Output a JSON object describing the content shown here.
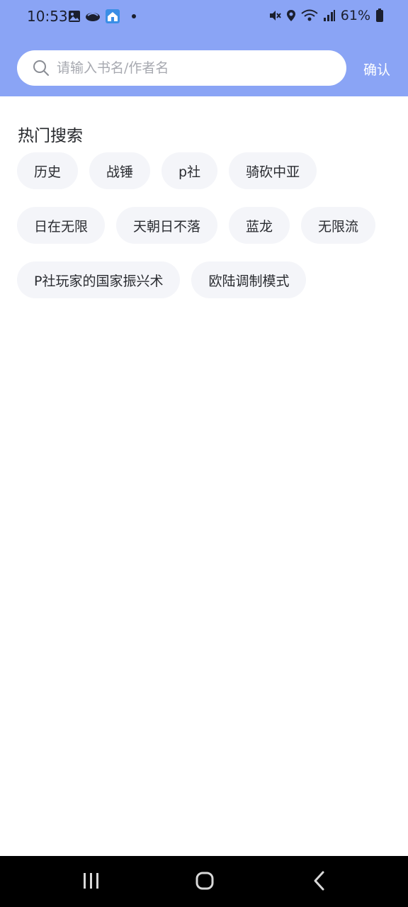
{
  "status_bar": {
    "time": "10:53",
    "battery": "61%"
  },
  "search": {
    "placeholder": "请输入书名/作者名",
    "value": "",
    "confirm_label": "确认"
  },
  "hot_search": {
    "title": "热门搜索",
    "rows": [
      [
        "历史",
        "战锤",
        "p社",
        "骑砍中亚"
      ],
      [
        "日在无限",
        "天朝日不落",
        "蓝龙",
        "无限流"
      ],
      [
        "P社玩家的国家振兴术",
        "欧陆调制模式"
      ]
    ]
  },
  "colors": {
    "header_bg": "#8aa4f5",
    "tag_bg": "#f4f5f9"
  },
  "icons": {
    "search": "search-icon",
    "nav_recents": "recents-icon",
    "nav_home": "home-icon",
    "nav_back": "back-icon"
  }
}
